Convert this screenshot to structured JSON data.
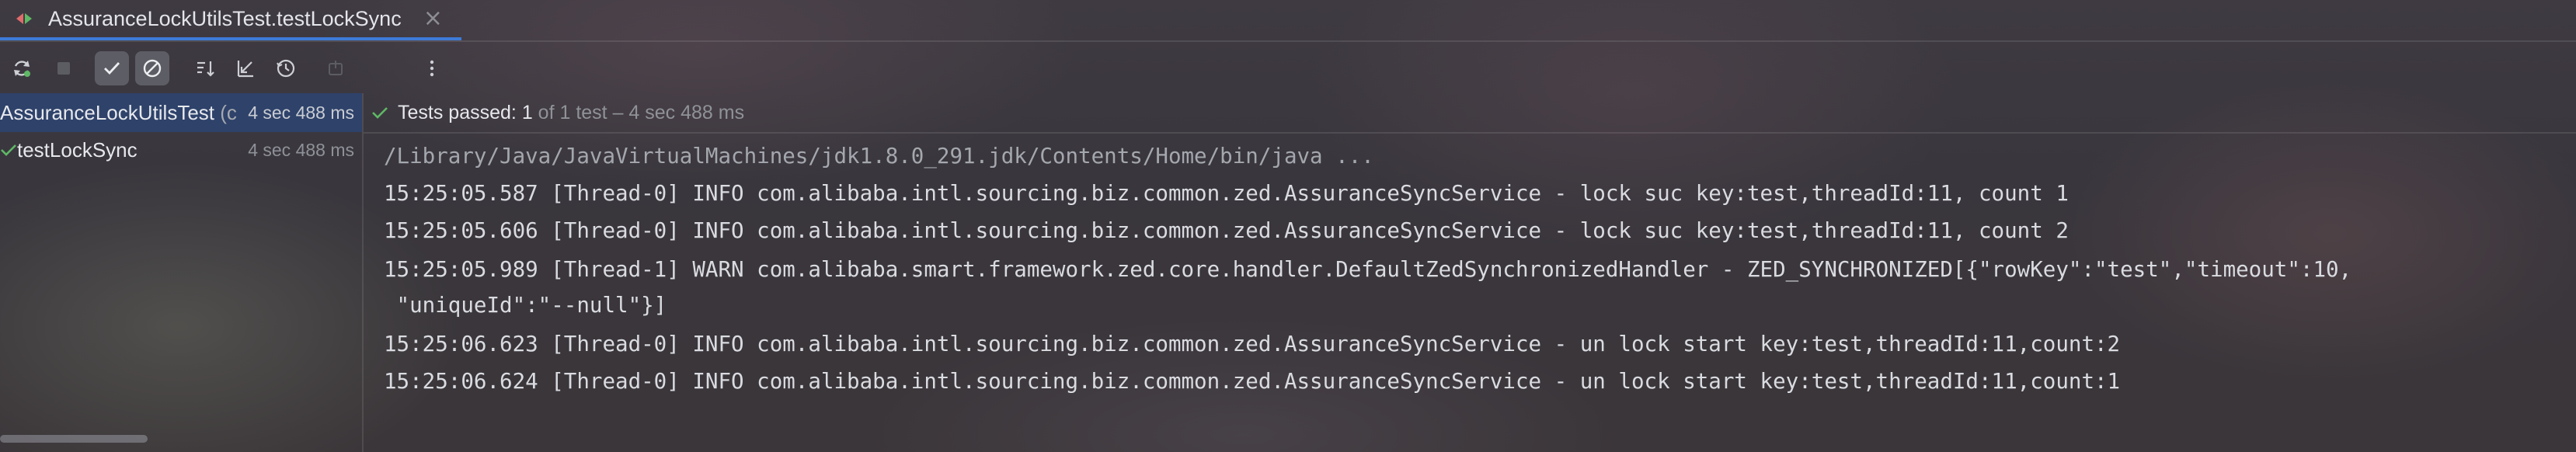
{
  "tab": {
    "title": "AssuranceLockUtilsTest.testLockSync",
    "close_glyph": "×"
  },
  "toolbar": {
    "buttons": [
      {
        "name": "rerun-icon",
        "active": false
      },
      {
        "name": "stop-icon",
        "active": false
      },
      {
        "name": "show-passed-icon",
        "active": true
      },
      {
        "name": "show-ignored-icon",
        "active": true
      },
      {
        "name": "sort-icon",
        "active": false
      },
      {
        "name": "collapse-icon",
        "active": false
      },
      {
        "name": "clock-icon",
        "active": false
      },
      {
        "name": "export-icon",
        "active": false
      },
      {
        "name": "more-options-icon",
        "active": false
      }
    ]
  },
  "tree": {
    "root": {
      "name": "AssuranceLockUtilsTest",
      "suffix": " (c",
      "time": "4 sec 488 ms"
    },
    "child": {
      "name": "testLockSync",
      "time": "4 sec 488 ms"
    }
  },
  "status": {
    "label": "Tests passed:",
    "count": "1",
    "of_total": "of 1 test",
    "separator": " – ",
    "duration": "4 sec 488 ms"
  },
  "console": {
    "lines": [
      "/Library/Java/JavaVirtualMachines/jdk1.8.0_291.jdk/Contents/Home/bin/java ...",
      "15:25:05.587 [Thread-0] INFO com.alibaba.intl.sourcing.biz.common.zed.AssuranceSyncService - lock suc key:test,threadId:11, count 1",
      "15:25:05.606 [Thread-0] INFO com.alibaba.intl.sourcing.biz.common.zed.AssuranceSyncService - lock suc key:test,threadId:11, count 2",
      "15:25:05.989 [Thread-1] WARN com.alibaba.smart.framework.zed.core.handler.DefaultZedSynchronizedHandler - ZED_SYNCHRONIZED[{\"rowKey\":\"test\",\"timeout\":10,",
      " \"uniqueId\":\"--null\"}]",
      "15:25:06.623 [Thread-0] INFO com.alibaba.intl.sourcing.biz.common.zed.AssuranceSyncService - un lock start key:test,threadId:11,count:2",
      "15:25:06.624 [Thread-0] INFO com.alibaba.intl.sourcing.biz.common.zed.AssuranceSyncService - un lock start key:test,threadId:11,count:1"
    ]
  },
  "colors": {
    "accent": "#3d7bd8",
    "pass_green": "#5fb865",
    "selection": "#2e436e"
  }
}
